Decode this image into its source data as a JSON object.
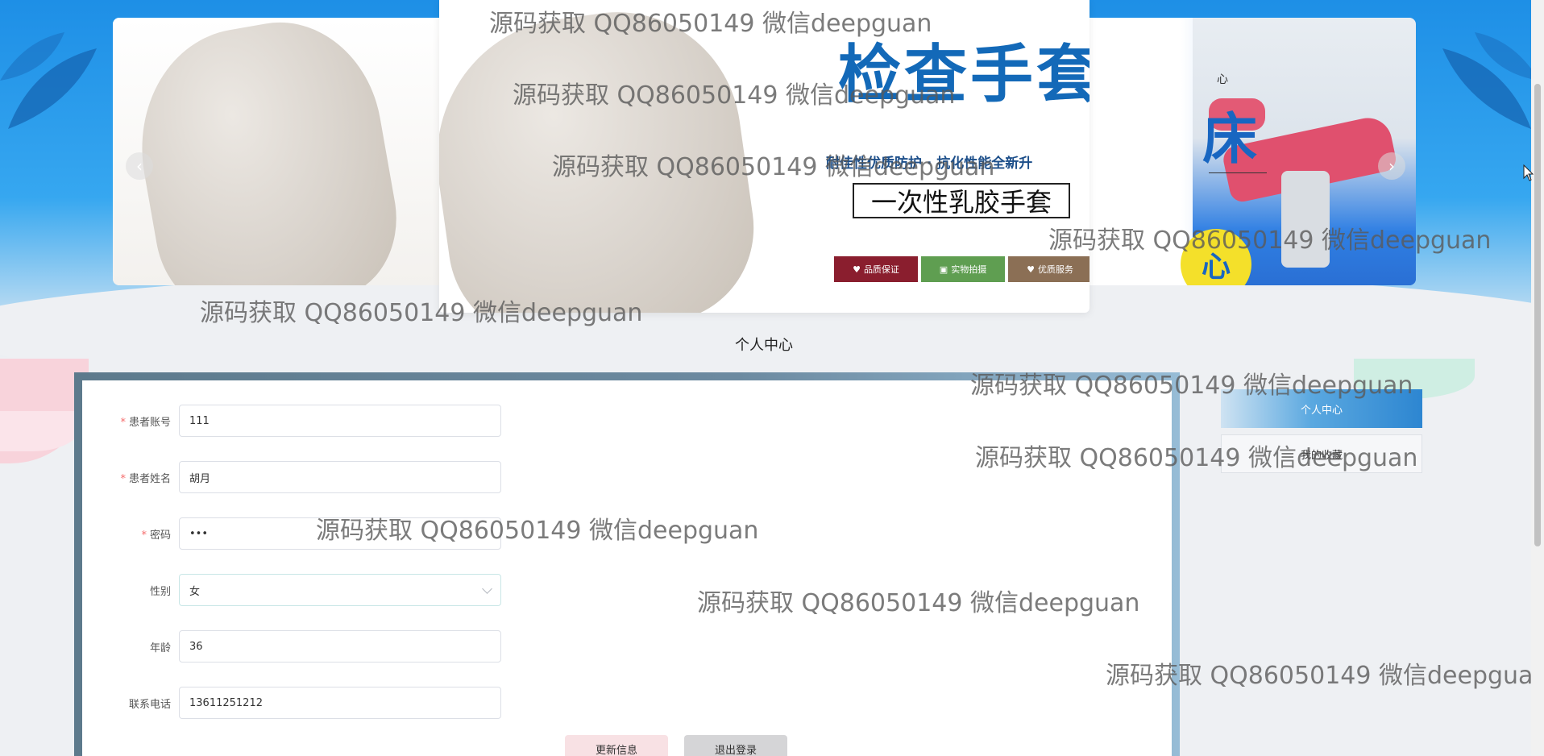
{
  "carousel": {
    "slide_title": "检查手套",
    "slide_subtitle": "耐佳性优质防护 · 抗化性能全新升",
    "slide_box_text": "一次性乳胶手套",
    "badges": [
      "品质保证",
      "实物拍摄",
      "优质服务"
    ],
    "side_small_text": "心",
    "side_big_char": "床",
    "side_disc_char": "心",
    "prev_arrow": "‹",
    "next_arrow": "›"
  },
  "section_title": "个人中心",
  "form": {
    "fields": [
      {
        "label": "患者账号",
        "required": true,
        "value": "111"
      },
      {
        "label": "患者姓名",
        "required": true,
        "value": "胡月"
      },
      {
        "label": "密码",
        "required": true,
        "value": "•••"
      },
      {
        "label": "性别",
        "required": false,
        "value": "女"
      },
      {
        "label": "年龄",
        "required": false,
        "value": "36"
      },
      {
        "label": "联系电话",
        "required": false,
        "value": "13611251212"
      }
    ],
    "required_mark": "*",
    "update_button": "更新信息",
    "logout_button": "退出登录"
  },
  "side_menu": {
    "items": [
      {
        "label": "个人中心",
        "active": true
      },
      {
        "label": "我的收藏",
        "active": false
      }
    ]
  },
  "watermark_text": "源码获取 QQ86050149 微信deepguan",
  "colors": {
    "primary_blue": "#2d86d1",
    "required_red": "#f56c6c",
    "update_button_bg": "#f8e1e4",
    "logout_button_bg": "#d5d5d7"
  }
}
